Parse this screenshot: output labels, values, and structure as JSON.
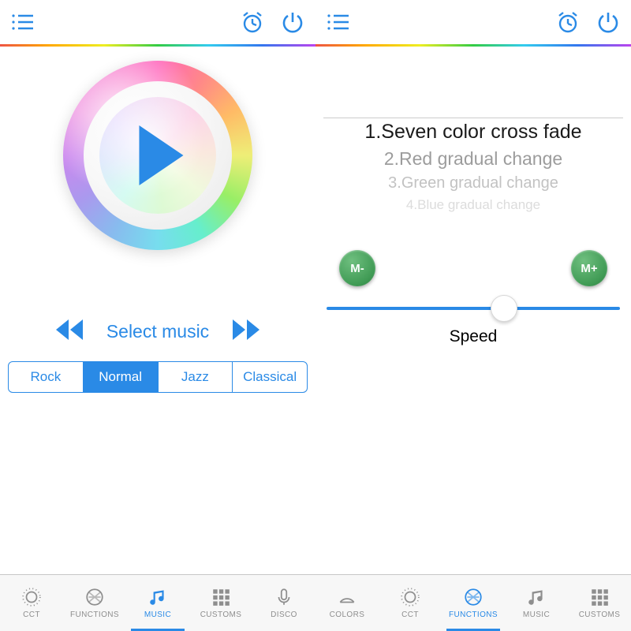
{
  "colors": {
    "accent": "#2a8ae6",
    "green": "#3f9a54"
  },
  "left": {
    "select_label": "Select music",
    "eq": [
      "Rock",
      "Normal",
      "Jazz",
      "Classical"
    ],
    "eq_active_index": 1,
    "tabs": [
      {
        "label": "CCT"
      },
      {
        "label": "FUNCTIONS"
      },
      {
        "label": "MUSIC"
      },
      {
        "label": "CUSTOMS"
      },
      {
        "label": "DISCO"
      }
    ],
    "active_tab_index": 2
  },
  "right": {
    "functions": [
      "1.Seven color cross fade",
      "2.Red gradual change",
      "3.Green gradual change",
      "4.Blue gradual change"
    ],
    "m_minus": "M-",
    "m_plus": "M+",
    "speed_label": "Speed",
    "tabs": [
      {
        "label": "COLORS"
      },
      {
        "label": "CCT"
      },
      {
        "label": "FUNCTIONS"
      },
      {
        "label": "MUSIC"
      },
      {
        "label": "CUSTOMS"
      }
    ],
    "active_tab_index": 2
  }
}
